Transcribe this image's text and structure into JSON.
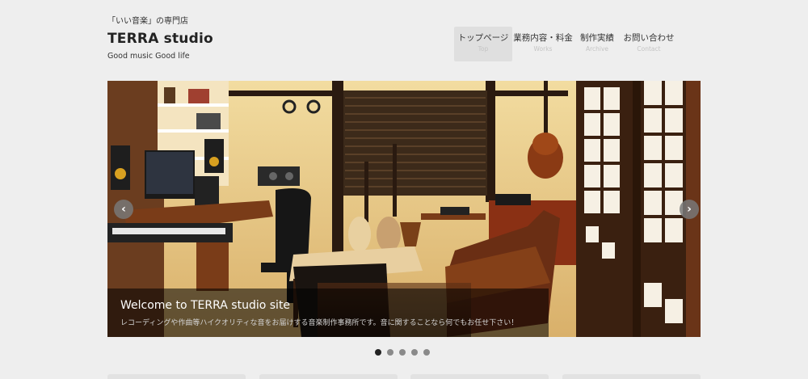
{
  "header": {
    "tagline": "「いい音楽」の専門店",
    "title": "TERRA studio",
    "subtitle": "Good music Good life"
  },
  "nav": {
    "items": [
      {
        "label": "トップページ",
        "sub": "Top",
        "active": true
      },
      {
        "label": "業務内容・料金",
        "sub": "Works"
      },
      {
        "label": "制作実績",
        "sub": "Archive"
      },
      {
        "label": "お問い合わせ",
        "sub": "Contact"
      }
    ]
  },
  "slider": {
    "caption_title": "Welcome to TERRA studio site",
    "caption_text": "レコーディングや作曲等ハイクオリティな音をお届けする音楽制作事務所です。音に関することなら何でもお任せ下さい！",
    "prev_icon": "chevron-left-icon",
    "next_icon": "chevron-right-icon",
    "prev_glyph": "‹",
    "next_glyph": "›",
    "slide_count": 5,
    "active_index": 0
  },
  "colors": {
    "background": "#eeeeee",
    "nav_active": "#dfdfdf",
    "dot_active": "#222222",
    "dot_inactive": "#8a8a8a"
  }
}
